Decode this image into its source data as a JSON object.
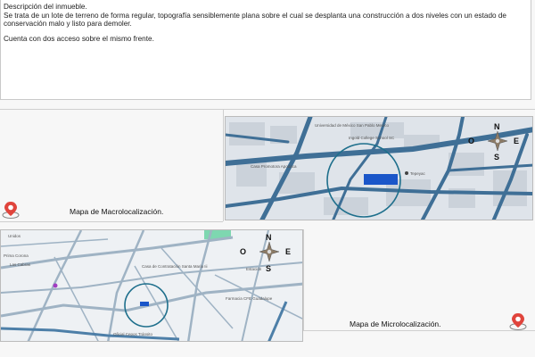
{
  "description": {
    "title": "Descripción del inmueble.",
    "paragraph1": "Se trata de un lote de terreno de forma regular, topografía sensiblemente plana sobre el cual se desplanta una construcción a dos niveles con un estado de conservación malo y listo para demoler.",
    "paragraph2": "Cuenta con dos acceso sobre el mismo frente."
  },
  "macro": {
    "caption": "Mapa de Macrolocalización.",
    "compass": {
      "n": "N",
      "s": "S",
      "e": "E",
      "o": "O"
    },
    "labels": [
      "Universidad de México San Pablo Mexico",
      "Ingold College School SC",
      "Casa Promotora Apodaca",
      "Tepeyac"
    ]
  },
  "micro": {
    "caption": "Mapa de Microlocalización.",
    "compass": {
      "n": "N",
      "s": "S",
      "e": "E",
      "o": "O"
    },
    "labels": [
      "Unidos",
      "Las Cabras",
      "Prima Corona",
      "Casa de Contratación Santa Maria Iii",
      "Estación",
      "Oficial Cepos Tránsito",
      "Farmacia CFE Guadalupe"
    ]
  },
  "colors": {
    "road": "#3f6f96",
    "circle": "#1e6f8c",
    "marker": "#1a56c9",
    "pin": "#e0443c"
  }
}
